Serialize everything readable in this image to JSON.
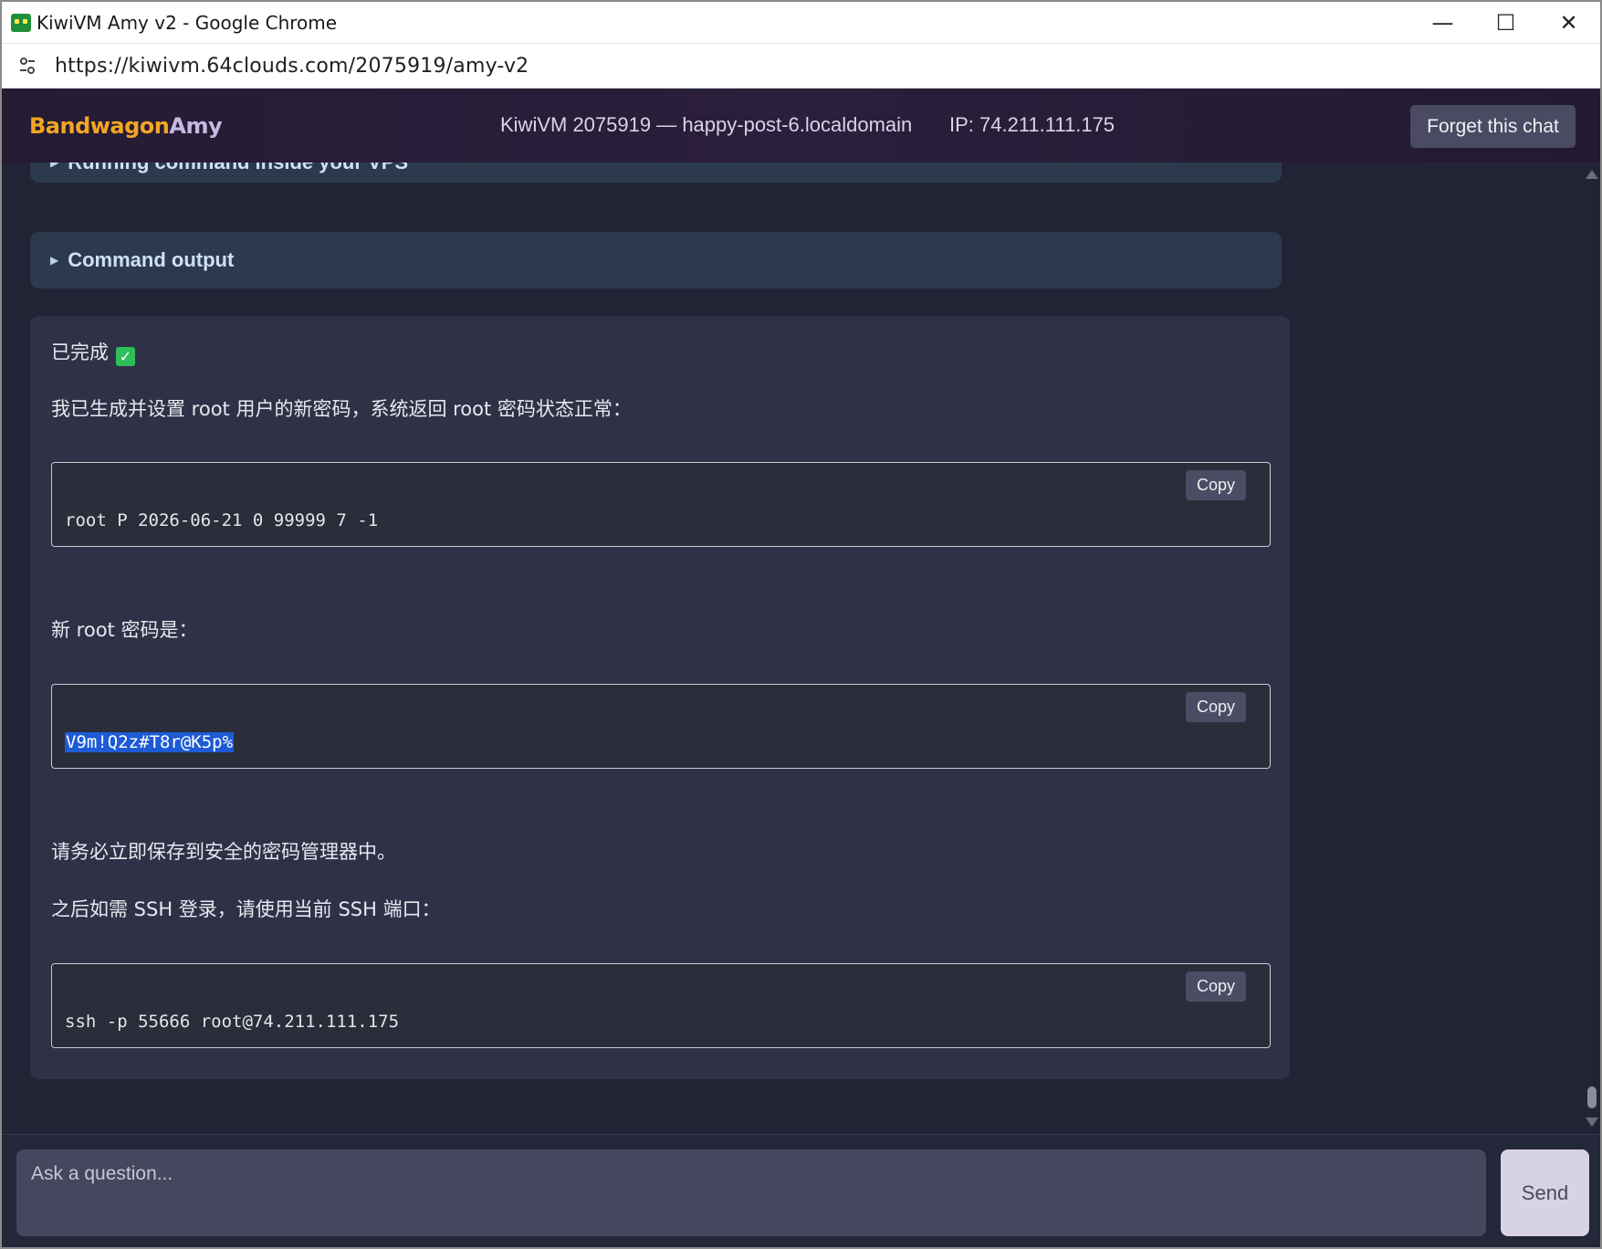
{
  "window": {
    "title": "KiwiVM Amy v2 - Google Chrome",
    "minimize": "—",
    "maximize": "☐",
    "close": "✕"
  },
  "address_bar": {
    "url": "https://kiwivm.64clouds.com/2075919/amy-v2"
  },
  "header": {
    "brand_part1": "Bandwagon",
    "brand_part2": "Amy",
    "vps": "KiwiVM 2075919 — happy-post-6.localdomain",
    "ip": "IP: 74.211.111.175",
    "forget_label": "Forget this chat"
  },
  "chat": {
    "details_1": "Running command inside your VPS",
    "details_2": "Command output",
    "message": {
      "done": "已完成",
      "line1": "我已生成并设置 root 用户的新密码，系统返回 root 密码状态正常：",
      "code1": "root P 2026-06-21 0 99999 7 -1",
      "line2": "新 root 密码是：",
      "code2": "V9m!Q2z#T8r@K5p%",
      "line3": "请务必立即保存到安全的密码管理器中。",
      "line4": "之后如需 SSH 登录，请使用当前 SSH 端口：",
      "code3": "ssh -p 55666 root@74.211.111.175",
      "copy_label": "Copy"
    }
  },
  "composer": {
    "placeholder": "Ask a question...",
    "send_label": "Send"
  },
  "colors": {
    "background": "#222436",
    "header": "#261b33",
    "brand_orange": "#f2a623",
    "selection": "#1d5bd6"
  }
}
